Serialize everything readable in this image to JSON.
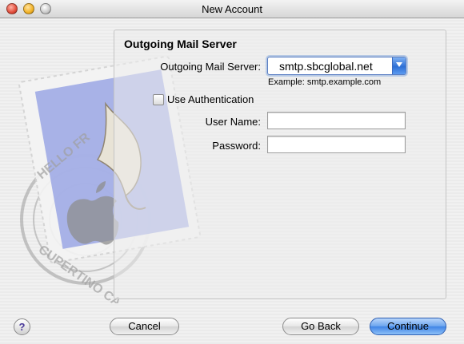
{
  "window": {
    "title": "New Account"
  },
  "section": {
    "title": "Outgoing Mail Server"
  },
  "server": {
    "label": "Outgoing Mail Server:",
    "value": "smtp.sbcglobal.net",
    "hint": "Example: smtp.example.com"
  },
  "auth": {
    "label": "Use Authentication",
    "checked": false
  },
  "user": {
    "label": "User Name:",
    "value": ""
  },
  "password": {
    "label": "Password:",
    "value": ""
  },
  "buttons": {
    "help": "?",
    "cancel": "Cancel",
    "back": "Go Back",
    "continue": "Continue"
  },
  "colors": {
    "accent": "#3f84e6",
    "help_glyph": "#4a3a9a"
  }
}
